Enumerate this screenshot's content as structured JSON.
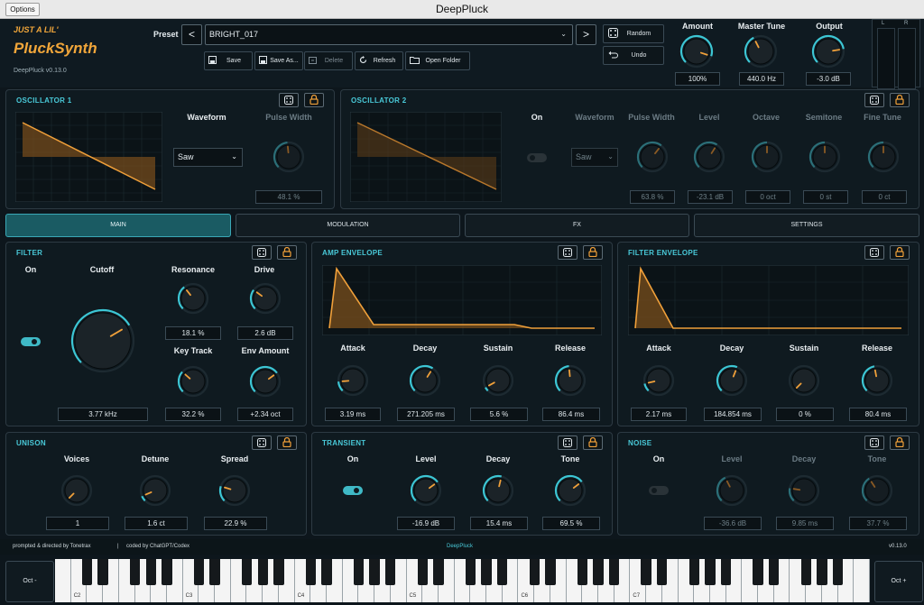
{
  "window": {
    "title": "DeepPluck",
    "options_label": "Options"
  },
  "header": {
    "tagline": "JUST A LIL'",
    "app_name": "PluckSynth",
    "version": "DeepPluck v0.13.0",
    "preset_label": "Preset",
    "preset_value": "BRIGHT_017",
    "prev_icon": "<",
    "next_icon": ">",
    "buttons": {
      "save": "Save",
      "save_as": "Save As...",
      "delete": "Delete",
      "refresh": "Refresh",
      "open_folder": "Open Folder",
      "random": "Random",
      "undo": "Undo"
    },
    "amount": {
      "label": "Amount",
      "value": "100%"
    },
    "master_tune": {
      "label": "Master Tune",
      "value": "440.0 Hz"
    },
    "output": {
      "label": "Output",
      "value": "-3.0 dB"
    },
    "meter": {
      "left": "L",
      "right": "R"
    }
  },
  "osc1": {
    "title": "OSCILLATOR 1",
    "waveform_label": "Waveform",
    "waveform_value": "Saw",
    "pulse_width_label": "Pulse Width",
    "pulse_width_value": "48.1 %"
  },
  "osc2": {
    "title": "OSCILLATOR 2",
    "on_label": "On",
    "waveform_label": "Waveform",
    "waveform_value": "Saw",
    "controls": [
      {
        "label": "Pulse Width",
        "value": "63.8 %"
      },
      {
        "label": "Level",
        "value": "-23.1 dB"
      },
      {
        "label": "Octave",
        "value": "0 oct"
      },
      {
        "label": "Semitone",
        "value": "0 st"
      },
      {
        "label": "Fine Tune",
        "value": "0 ct"
      }
    ]
  },
  "tabs": [
    "MAIN",
    "MODULATION",
    "FX",
    "SETTINGS"
  ],
  "filter": {
    "title": "FILTER",
    "on_label": "On",
    "cutoff_label": "Cutoff",
    "cutoff_value": "3.77 kHz",
    "resonance_label": "Resonance",
    "resonance_value": "18.1 %",
    "drive_label": "Drive",
    "drive_value": "2.6 dB",
    "keytrack_label": "Key Track",
    "keytrack_value": "32.2 %",
    "envamt_label": "Env Amount",
    "envamt_value": "+2.34 oct"
  },
  "amp_env": {
    "title": "AMP ENVELOPE",
    "controls": [
      {
        "label": "Attack",
        "value": "3.19 ms"
      },
      {
        "label": "Decay",
        "value": "271.205 ms"
      },
      {
        "label": "Sustain",
        "value": "5.6 %"
      },
      {
        "label": "Release",
        "value": "86.4 ms"
      }
    ]
  },
  "filter_env": {
    "title": "FILTER ENVELOPE",
    "controls": [
      {
        "label": "Attack",
        "value": "2.17 ms"
      },
      {
        "label": "Decay",
        "value": "184.854 ms"
      },
      {
        "label": "Sustain",
        "value": "0 %"
      },
      {
        "label": "Release",
        "value": "80.4 ms"
      }
    ]
  },
  "unison": {
    "title": "UNISON",
    "controls": [
      {
        "label": "Voices",
        "value": "1"
      },
      {
        "label": "Detune",
        "value": "1.6 ct"
      },
      {
        "label": "Spread",
        "value": "22.9 %"
      }
    ]
  },
  "transient": {
    "title": "TRANSIENT",
    "on_label": "On",
    "controls": [
      {
        "label": "Level",
        "value": "-16.9 dB"
      },
      {
        "label": "Decay",
        "value": "15.4 ms"
      },
      {
        "label": "Tone",
        "value": "69.5 %"
      }
    ]
  },
  "noise": {
    "title": "NOISE",
    "on_label": "On",
    "controls": [
      {
        "label": "Level",
        "value": "-36.6 dB"
      },
      {
        "label": "Decay",
        "value": "9.85 ms"
      },
      {
        "label": "Tone",
        "value": "37.7 %"
      }
    ]
  },
  "footer": {
    "credit1": "prompted & directed by Tonetrax",
    "separator": "|",
    "credit2": "coded by ChatGPT/Codex",
    "center": "DeepPluck",
    "version": "v0.13.0"
  },
  "keyboard": {
    "oct_down": "Oct -",
    "oct_up": "Oct +",
    "c_labels": [
      "C2",
      "C3",
      "C4",
      "C5",
      "C6",
      "C7"
    ]
  },
  "colors": {
    "accent": "#3cc6d4",
    "orange": "#f0a03a",
    "panel": "#0f1a20",
    "bg": "#0d161c"
  }
}
